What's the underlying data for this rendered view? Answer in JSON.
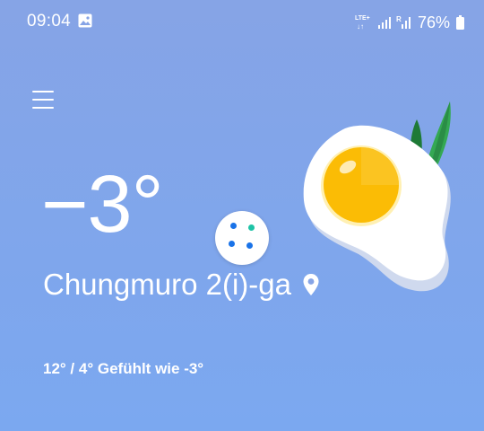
{
  "status_bar": {
    "time": "09:04",
    "network_label": "LTE+",
    "signal_roaming_label": "R",
    "battery_percent": "76%"
  },
  "weather": {
    "current_temp": "−3°",
    "location": "Chungmuro 2(i)-ga",
    "details": "12° / 4° Gefühlt wie -3°"
  },
  "icons": {
    "menu": "menu-icon",
    "location": "location-pin-icon",
    "gallery": "gallery-icon",
    "fab": "four-dots-icon",
    "illustration": "fried-egg-illustration"
  },
  "colors": {
    "background_top": "#86a4e6",
    "background_bottom": "#7ba8f0",
    "dot_blue": "#1a73e8",
    "dot_green": "#1ec3a6",
    "egg_yolk": "#fbbc05"
  }
}
